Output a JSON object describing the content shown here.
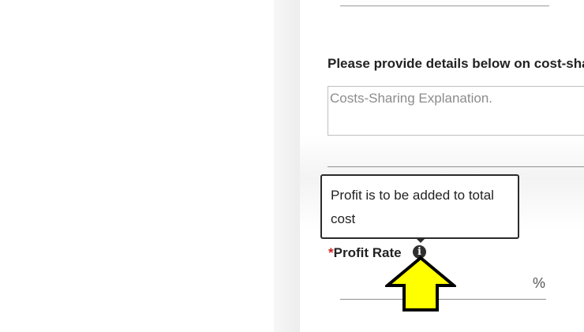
{
  "cost_sharing": {
    "label": "Please provide details below on cost-sharing",
    "placeholder": "Costs-Sharing Explanation."
  },
  "tooltip": {
    "text": "Profit is to be added to total cost"
  },
  "profit_rate": {
    "required_mark": "*",
    "label": "Profit Rate",
    "value": "",
    "unit": "%"
  },
  "icons": {
    "info": "info-icon",
    "pointer": "arrow-up-icon"
  },
  "colors": {
    "required": "#d22020",
    "arrow_fill": "#ffff00",
    "tooltip_border": "#2b2b2b"
  }
}
